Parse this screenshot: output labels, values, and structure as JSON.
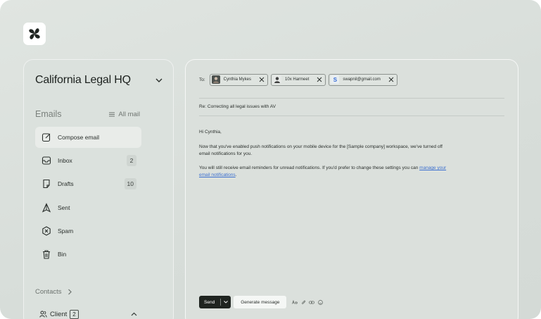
{
  "workspace": {
    "name": "California Legal HQ"
  },
  "emails": {
    "title": "Emails",
    "all_mail_label": "All mail"
  },
  "nav": [
    {
      "key": "compose",
      "label": "Compose email",
      "icon": "compose-icon",
      "badge": ""
    },
    {
      "key": "inbox",
      "label": "Inbox",
      "icon": "inbox-icon",
      "badge": "2"
    },
    {
      "key": "drafts",
      "label": "Drafts",
      "icon": "drafts-icon",
      "badge": "10"
    },
    {
      "key": "sent",
      "label": "Sent",
      "icon": "send-icon",
      "badge": ""
    },
    {
      "key": "spam",
      "label": "Spam",
      "icon": "spam-icon",
      "badge": ""
    },
    {
      "key": "bin",
      "label": "Bin",
      "icon": "trash-icon",
      "badge": ""
    }
  ],
  "contacts": {
    "label": "Contacts",
    "client_label": "Client",
    "client_count": "2"
  },
  "composer": {
    "to_label": "To:",
    "recipients": [
      {
        "name": "Cynthia Mykes",
        "avatar": "photo"
      },
      {
        "name": "10x Harmeet",
        "avatar": "photo"
      },
      {
        "name": "swapnil@gmail.com",
        "avatar": "S"
      }
    ],
    "subject": "Re: Correcting all legal issues with AV",
    "greeting": "Hi Cynthia,",
    "para1": "Now that you've enabled push notifications on your mobile device for the [Sample company] workspace, we've turned off email notifications for you.",
    "para2_before": "You will still receive email reminders for unread notifications. If you'd prefer to change these settings you can ",
    "para2_link": "manage your email notifications",
    "para2_after": ".",
    "send_label": "Send",
    "generate_label": "Generate message",
    "tools": [
      "text-format-icon",
      "attachment-icon",
      "link-icon",
      "emoji-icon"
    ]
  },
  "colors": {
    "accent_link": "#3b6fcf",
    "send_bg": "#1f2420",
    "background": "#d7ddd9"
  }
}
